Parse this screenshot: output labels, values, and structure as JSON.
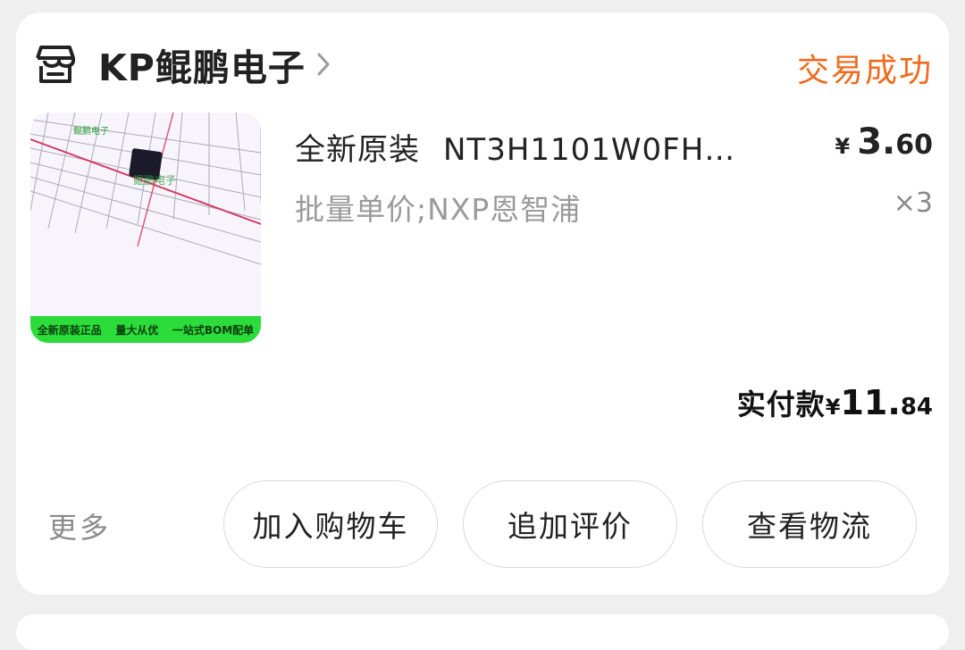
{
  "shop": {
    "name": "KP鲲鹏电子",
    "status": "交易成功",
    "status_color": "#f06a1e",
    "icon": "store-icon"
  },
  "product": {
    "title_prefix": "全新原装",
    "title_main": "NT3H1101W0FH…",
    "sku": "批量单价;NXP恩智浦",
    "price_currency": "¥",
    "price_int": "3.",
    "price_dec": "60",
    "quantity": "×3",
    "thumbnail": {
      "logo_text": "鲲鹏电子",
      "banner_items": [
        "全新原装正品",
        "量大从优",
        "一站式BOM配单"
      ],
      "banner_color": "#2bdc3a"
    }
  },
  "payment": {
    "label": "实付款",
    "currency": "¥",
    "amount_int": "11.",
    "amount_dec": "84"
  },
  "actions": {
    "more": "更多",
    "add_to_cart": "加入购物车",
    "add_review": "追加评价",
    "view_logistics": "查看物流"
  }
}
